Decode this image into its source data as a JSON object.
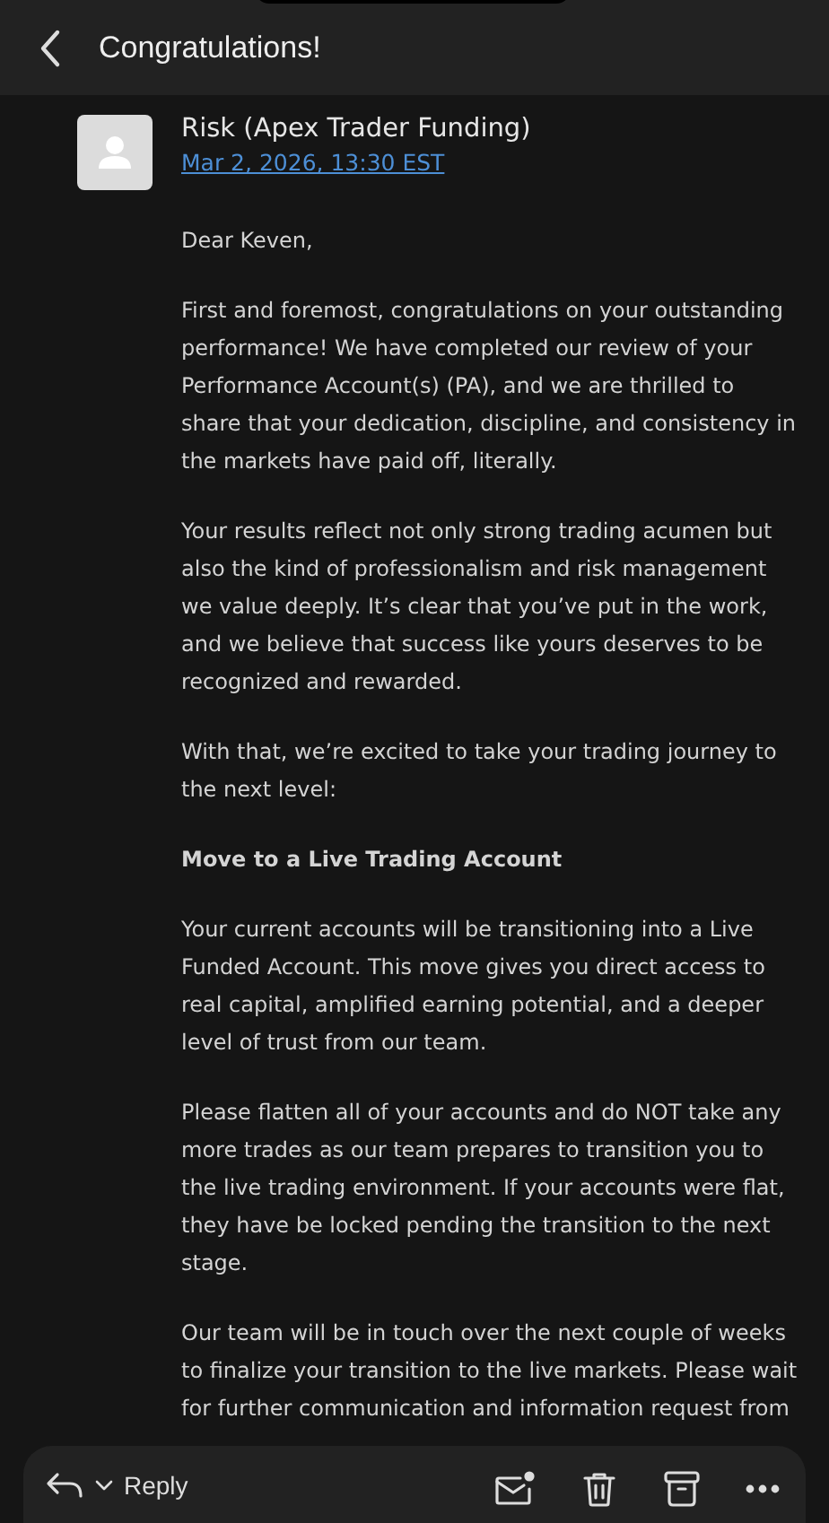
{
  "header": {
    "title": "Congratulations!"
  },
  "sender": {
    "name": "Risk (Apex Trader Funding)",
    "date": "Mar 2, 2026, 13:30 EST"
  },
  "body": [
    {
      "kind": "text",
      "text": "Dear Keven,"
    },
    {
      "kind": "text",
      "text": "First and foremost, congratulations on your outstanding performance! We have completed our review of your Performance Account(s) (PA), and we are thrilled to share that your dedication, discipline, and consistency in the markets have paid off, literally."
    },
    {
      "kind": "text",
      "text": "Your results reflect not only strong trading acumen but also the kind of professionalism and risk management we value deeply. It’s clear that you’ve put in the work, and we believe that success like yours deserves to be recognized and rewarded."
    },
    {
      "kind": "text",
      "text": "With that, we’re excited to take your trading journey to the next level:"
    },
    {
      "kind": "heading",
      "text": "Move to a Live Trading Account"
    },
    {
      "kind": "text",
      "text": "Your current accounts will be transitioning into a Live Funded Account. This move gives you direct access to real capital, amplified earning potential, and a deeper level of trust from our team."
    },
    {
      "kind": "text",
      "text": "Please flatten all of your accounts and do NOT take any more trades as our team prepares to transition you to the live trading environment. If your accounts were flat, they have be locked pending the transition to the next stage."
    },
    {
      "kind": "text",
      "text": "Our team will be in touch over the next couple of weeks to finalize your transition to the live markets. Please wait for further communication and information request from"
    }
  ],
  "toolbar": {
    "reply_label": "Reply"
  }
}
